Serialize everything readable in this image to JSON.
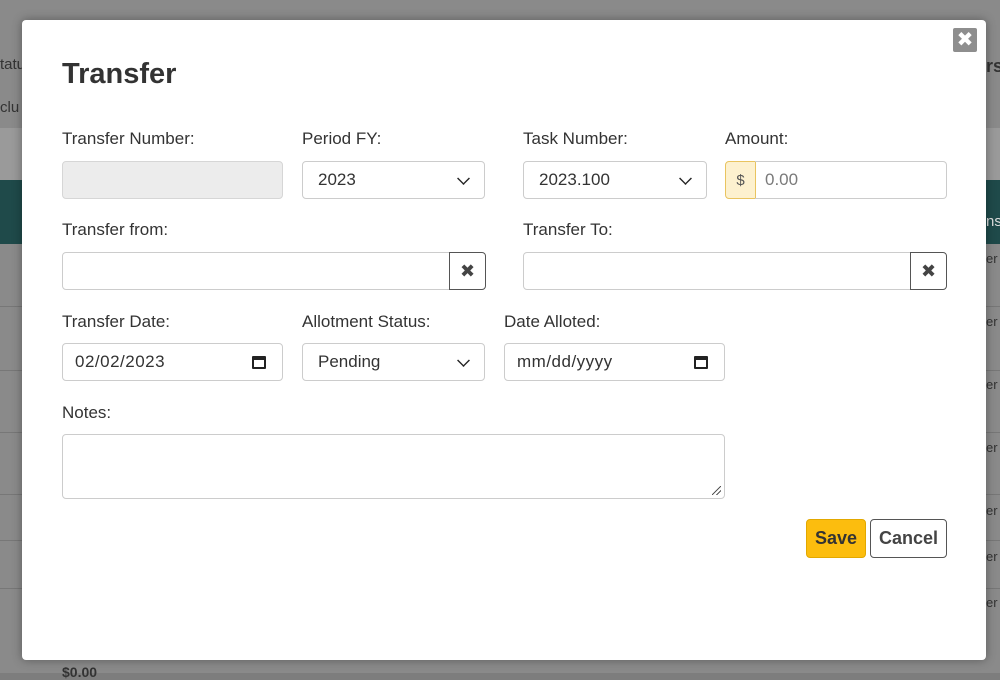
{
  "background": {
    "left_texts": [
      "tatu",
      "clu"
    ],
    "right_texts": [
      "rs",
      "ns"
    ],
    "row_tail_text": "er",
    "bottom_value": "$0.00"
  },
  "modal": {
    "title": "Transfer",
    "close_glyph": "✖",
    "fields": {
      "transfer_number": {
        "label": "Transfer Number:",
        "value": ""
      },
      "period_fy": {
        "label": "Period FY:",
        "value": "2023"
      },
      "task_number": {
        "label": "Task Number:",
        "value": "2023.100"
      },
      "amount": {
        "label": "Amount:",
        "currency_symbol": "$",
        "placeholder": "0.00"
      },
      "transfer_from": {
        "label": "Transfer from:",
        "value": "",
        "clear_glyph": "✖"
      },
      "transfer_to": {
        "label": "Transfer To:",
        "value": "",
        "clear_glyph": "✖"
      },
      "transfer_date": {
        "label": "Transfer Date:",
        "value": "02/02/2023"
      },
      "allotment_status": {
        "label": "Allotment Status:",
        "value": "Pending"
      },
      "date_alloted": {
        "label": "Date Alloted:",
        "placeholder": "mm/dd/yyyy"
      },
      "notes": {
        "label": "Notes:",
        "value": ""
      }
    },
    "buttons": {
      "save": "Save",
      "cancel": "Cancel"
    }
  },
  "colors": {
    "accent": "#fcbd0e",
    "overlay": "#8a8a8a",
    "header_band": "#1f4a4a"
  }
}
